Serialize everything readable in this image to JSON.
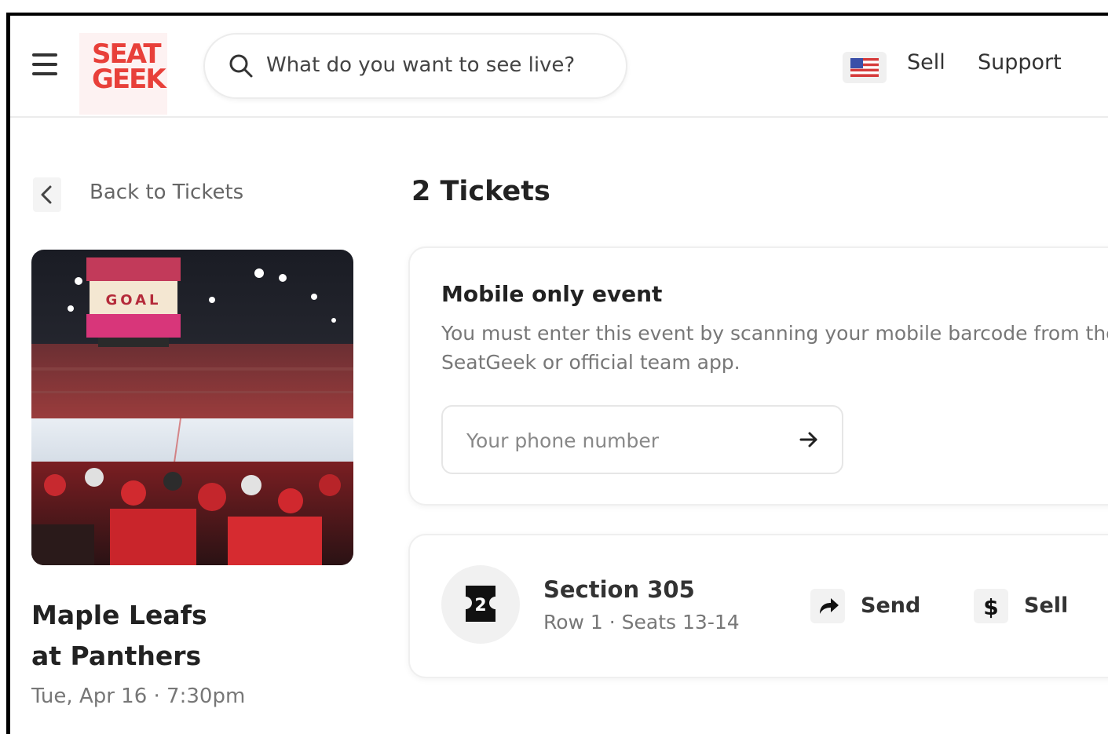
{
  "header": {
    "logo_line1": "SEAT",
    "logo_line2": "GEEK",
    "search_placeholder": "What do you want to see live?",
    "nav": {
      "sell": "Sell",
      "support": "Support"
    }
  },
  "sidebar": {
    "back_label": "Back to Tickets",
    "event_title_line1": "Maple Leafs",
    "event_title_line2": "at Panthers",
    "event_date": "Tue, Apr 16 · 7:30pm",
    "image_text": "GOAL"
  },
  "main": {
    "heading": "2 Tickets",
    "mobile_notice": {
      "title": "Mobile only event",
      "description": "You must enter this event by scanning your mobile barcode from the SeatGeek or official team app.",
      "phone_placeholder": "Your phone number"
    },
    "ticket": {
      "count": "2",
      "section": "Section 305",
      "details": "Row 1 · Seats 13-14",
      "send_label": "Send",
      "sell_label": "Sell"
    }
  },
  "colors": {
    "brand": "#e8403a",
    "text_primary": "#222222",
    "text_secondary": "#777777",
    "border": "#ececec"
  },
  "icons": [
    "menu-icon",
    "search-icon",
    "us-flag-icon",
    "chevron-left-icon",
    "arrow-right-icon",
    "ticket-icon",
    "share-arrow-icon",
    "dollar-icon"
  ]
}
